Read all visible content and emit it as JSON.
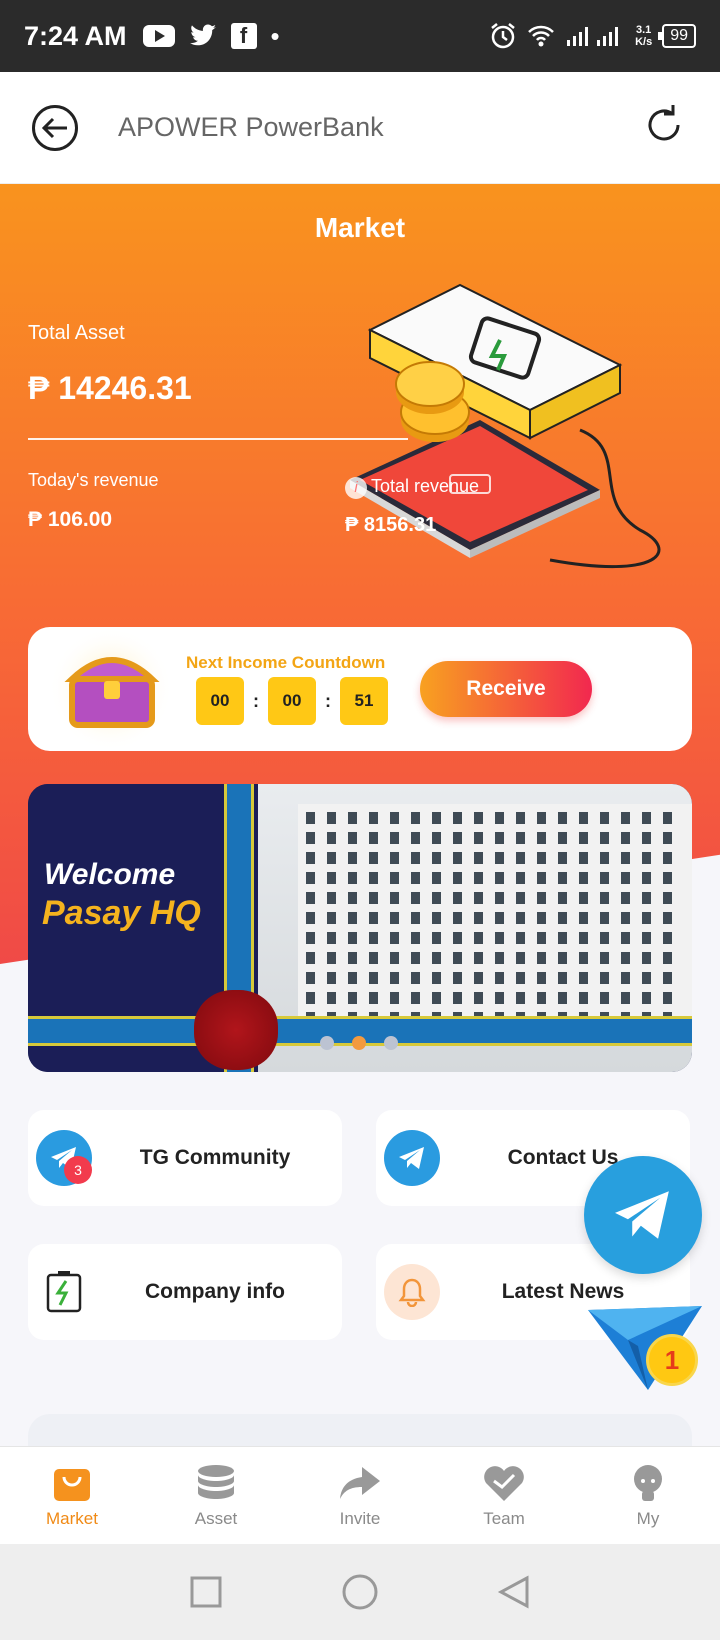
{
  "status_bar": {
    "time": "7:24 AM",
    "speed_top": "3.1",
    "speed_bottom": "K/s",
    "battery": "99"
  },
  "header": {
    "title": "APOWER PowerBank"
  },
  "hero": {
    "title": "Market",
    "total_asset_label": "Total Asset",
    "total_asset_value": "₱ 14246.31",
    "today_revenue_label": "Today's revenue",
    "today_revenue_value": "₱ 106.00",
    "total_revenue_label": "Total revenue",
    "total_revenue_value": "₱ 8156.31"
  },
  "countdown": {
    "title": "Next Income Countdown",
    "hours": "00",
    "minutes": "00",
    "seconds": "51",
    "separator": ":",
    "receive_label": "Receive"
  },
  "banner": {
    "line1": "Welcome",
    "line2": "Pasay HQ",
    "active_slide": 2,
    "slide_count": 3
  },
  "quick_links": [
    {
      "label": "TG Community",
      "icon": "telegram-icon",
      "badge": "3"
    },
    {
      "label": "Contact Us",
      "icon": "telegram-icon"
    },
    {
      "label": "Company info",
      "icon": "powerbank-icon"
    },
    {
      "label": "Latest News",
      "icon": "bell-icon"
    }
  ],
  "floating": {
    "badge": "1"
  },
  "bottom_nav": [
    {
      "label": "Market",
      "icon": "shopping-bag-icon",
      "active": true
    },
    {
      "label": "Asset",
      "icon": "database-icon"
    },
    {
      "label": "Invite",
      "icon": "share-icon"
    },
    {
      "label": "Team",
      "icon": "heart-handshake-icon"
    },
    {
      "label": "My",
      "icon": "user-icon"
    }
  ],
  "colors": {
    "accent": "#f08a16",
    "hero_top": "#f9931e",
    "hero_bottom": "#f04a47",
    "telegram": "#2a9be0",
    "countdown_box": "#ffc815"
  }
}
